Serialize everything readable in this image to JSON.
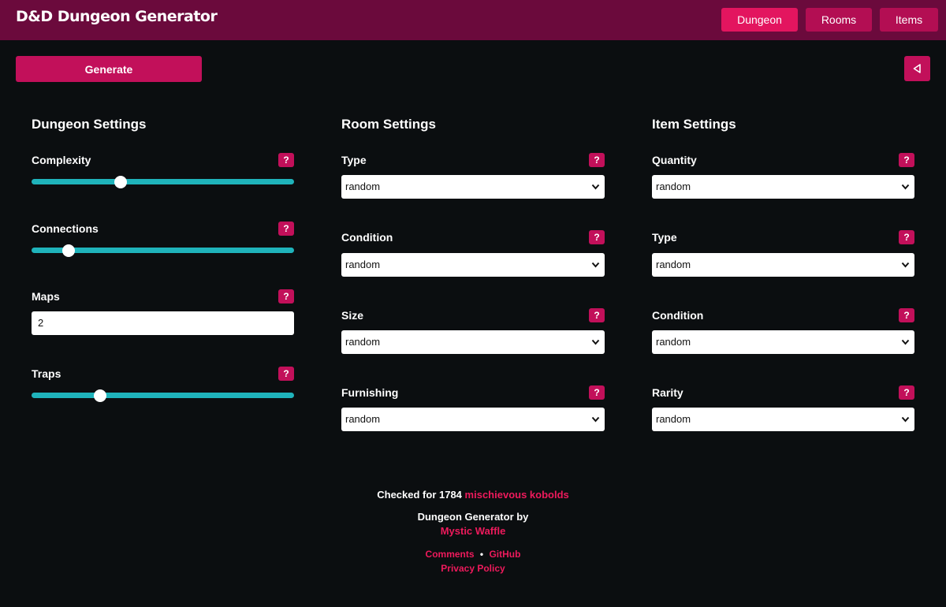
{
  "header": {
    "title": "D&D Dungeon Generator",
    "nav": [
      {
        "label": "Dungeon",
        "active": true
      },
      {
        "label": "Rooms",
        "active": false
      },
      {
        "label": "Items",
        "active": false
      }
    ]
  },
  "toolbar": {
    "generate_label": "Generate",
    "collapse_icon": "triangle-left-icon"
  },
  "dungeon_settings": {
    "title": "Dungeon Settings",
    "complexity": {
      "label": "Complexity",
      "help": "?",
      "value": 0.34
    },
    "connections": {
      "label": "Connections",
      "help": "?",
      "value": 0.14
    },
    "maps": {
      "label": "Maps",
      "help": "?",
      "value": "2"
    },
    "traps": {
      "label": "Traps",
      "help": "?",
      "value": 0.26
    }
  },
  "room_settings": {
    "title": "Room Settings",
    "type": {
      "label": "Type",
      "help": "?",
      "value": "random"
    },
    "condition": {
      "label": "Condition",
      "help": "?",
      "value": "random"
    },
    "size": {
      "label": "Size",
      "help": "?",
      "value": "random"
    },
    "furnishing": {
      "label": "Furnishing",
      "help": "?",
      "value": "random"
    }
  },
  "item_settings": {
    "title": "Item Settings",
    "quantity": {
      "label": "Quantity",
      "help": "?",
      "value": "random"
    },
    "type": {
      "label": "Type",
      "help": "?",
      "value": "random"
    },
    "condition": {
      "label": "Condition",
      "help": "?",
      "value": "random"
    },
    "rarity": {
      "label": "Rarity",
      "help": "?",
      "value": "random"
    }
  },
  "footer": {
    "checked_prefix": "Checked for 1784",
    "checked_link": "mischievous kobolds",
    "byline": "Dungeon Generator by",
    "author": "Mystic Waffle",
    "comments": "Comments",
    "separator": "•",
    "github": "GitHub",
    "privacy": "Privacy Policy"
  },
  "colors": {
    "header_bg": "#6b0a3c",
    "accent": "#c2105a",
    "accent_active": "#e3155f",
    "slider": "#1fb3bb",
    "link": "#ee1a5c",
    "background": "#0b0e10"
  }
}
